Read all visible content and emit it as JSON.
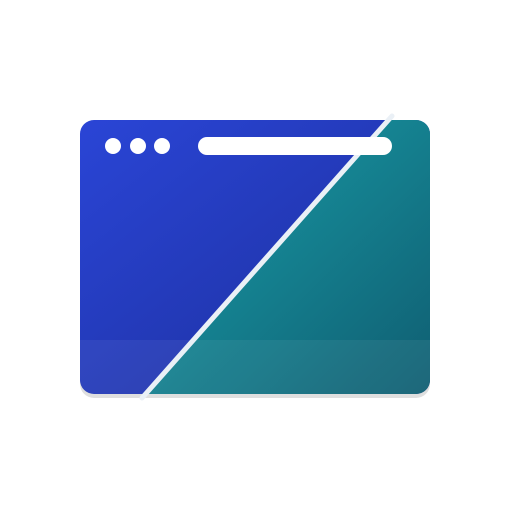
{
  "app_icon": {
    "icon": "browser-window-split-icon",
    "colors": {
      "left_panel_start": "#2a45d6",
      "left_panel_end": "#1c2e9a",
      "right_panel_start": "#1aa3ad",
      "right_panel_end": "#0f5c70",
      "divider": "#eaf0f6",
      "shadow": "#b8b8b8",
      "window_controls": "#ffffff",
      "address_bar": "#ffffff"
    },
    "window_controls": [
      "close-dot",
      "minimize-dot",
      "maximize-dot"
    ],
    "address_bar": {
      "value": ""
    }
  }
}
